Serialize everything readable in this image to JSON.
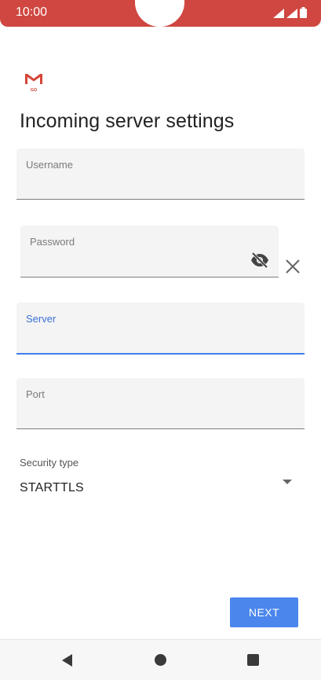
{
  "status_bar": {
    "time": "10:00"
  },
  "page_title": "Incoming server settings",
  "fields": {
    "username": {
      "label": "Username",
      "value": ""
    },
    "password": {
      "label": "Password",
      "value": ""
    },
    "server": {
      "label": "Server",
      "value": ""
    },
    "port": {
      "label": "Port",
      "value": ""
    }
  },
  "security": {
    "label": "Security type",
    "value": "STARTTLS"
  },
  "next_label": "NEXT",
  "colors": {
    "status_bar": "#cf4740",
    "accent": "#4a86ec",
    "field_bg": "#f4f4f4"
  },
  "icons": [
    "gmail-go-logo",
    "visibility-off-icon",
    "close-icon",
    "dropdown-arrow-icon",
    "back-icon",
    "home-icon",
    "recents-icon"
  ]
}
